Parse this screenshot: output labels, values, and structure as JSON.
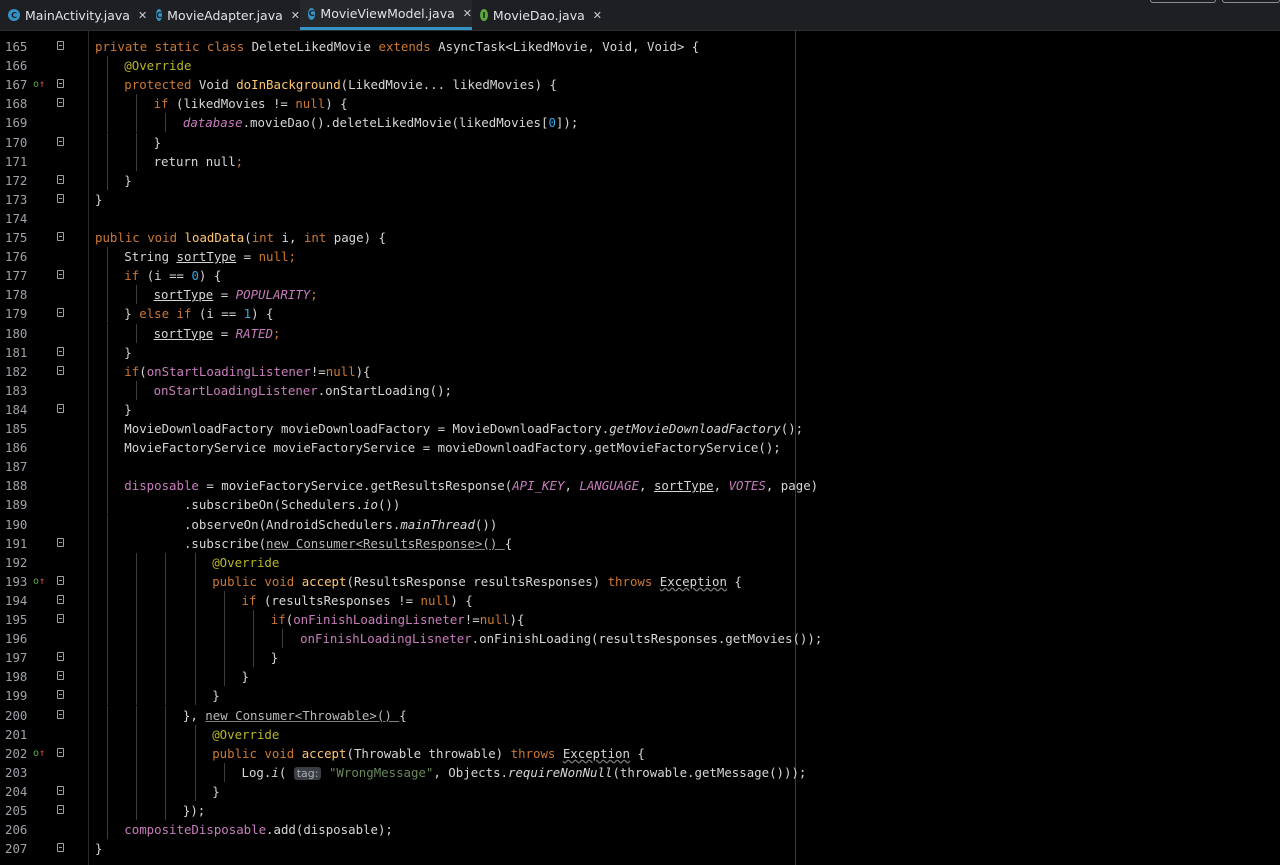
{
  "tabs": [
    {
      "label": "MainActivity.java",
      "icon": "C",
      "color": "#3592c4",
      "active": false
    },
    {
      "label": "MovieAdapter.java",
      "icon": "C",
      "color": "#3592c4",
      "active": false
    },
    {
      "label": "MovieViewModel.java",
      "icon": "C",
      "color": "#3592c4",
      "active": true
    },
    {
      "label": "MovieDao.java",
      "icon": "I",
      "color": "#5aab3c",
      "active": false
    }
  ],
  "close_glyph": "✕",
  "override_glyph": "o↑",
  "lines": [
    {
      "n": "165",
      "ind": 0,
      "fold": true,
      "c": [
        [
          "private static class ",
          "k"
        ],
        [
          "DeleteLikedMovie ",
          ""
        ],
        [
          "extends ",
          "k"
        ],
        [
          "AsyncTask<LikedMovie, Void, Void> {",
          ""
        ]
      ]
    },
    {
      "n": "166",
      "ind": 1,
      "c": [
        [
          "@Override",
          "ann"
        ]
      ]
    },
    {
      "n": "167",
      "ind": 1,
      "fold": true,
      "ovr": true,
      "c": [
        [
          "protected ",
          "k"
        ],
        [
          "Void ",
          ""
        ],
        [
          "doInBackground",
          "fn"
        ],
        [
          "(LikedMovie... likedMovies) {",
          ""
        ]
      ]
    },
    {
      "n": "168",
      "ind": 2,
      "fold": true,
      "c": [
        [
          "if ",
          "k"
        ],
        [
          "(likedMovies != ",
          ""
        ],
        [
          "null",
          "k"
        ],
        [
          ") {",
          ""
        ]
      ]
    },
    {
      "n": "169",
      "ind": 3,
      "c": [
        [
          "database",
          "pfi"
        ],
        [
          ".movieDao().deleteLikedMovie(likedMovies[",
          ""
        ],
        [
          "0",
          "num"
        ],
        [
          "]);",
          ""
        ]
      ]
    },
    {
      "n": "170",
      "ind": 2,
      "fold": true,
      "c": [
        [
          "}",
          ""
        ]
      ]
    },
    {
      "n": "171",
      "ind": 2,
      "c": [
        [
          "return null",
          ""
        ],
        [
          ";",
          "k"
        ]
      ]
    },
    {
      "n": "172",
      "ind": 1,
      "fold": true,
      "c": [
        [
          "}",
          ""
        ]
      ]
    },
    {
      "n": "173",
      "ind": 0,
      "fold": true,
      "c": [
        [
          "}",
          ""
        ]
      ]
    },
    {
      "n": "174",
      "ind": 0,
      "c": []
    },
    {
      "n": "175",
      "ind": 0,
      "fold": true,
      "c": [
        [
          "public void ",
          "k"
        ],
        [
          "loadData",
          "fn"
        ],
        [
          "(",
          ""
        ],
        [
          "int ",
          "k"
        ],
        [
          "i, ",
          ""
        ],
        [
          "int ",
          "k"
        ],
        [
          "page) {",
          ""
        ]
      ]
    },
    {
      "n": "176",
      "ind": 1,
      "c": [
        [
          "String ",
          ""
        ],
        [
          "sortType",
          "ul"
        ],
        [
          " = ",
          ""
        ],
        [
          "null",
          "k"
        ],
        [
          ";",
          "k"
        ]
      ]
    },
    {
      "n": "177",
      "ind": 1,
      "fold": true,
      "c": [
        [
          "if ",
          "k"
        ],
        [
          "(i == ",
          ""
        ],
        [
          "0",
          "num"
        ],
        [
          ") {",
          ""
        ]
      ]
    },
    {
      "n": "178",
      "ind": 2,
      "c": [
        [
          "sortType",
          "ul"
        ],
        [
          " = ",
          ""
        ],
        [
          "POPULARITY",
          "pfi"
        ],
        [
          ";",
          "k"
        ]
      ]
    },
    {
      "n": "179",
      "ind": 1,
      "fold": true,
      "c": [
        [
          "} ",
          ""
        ],
        [
          "else if ",
          "k"
        ],
        [
          "(i == ",
          ""
        ],
        [
          "1",
          "num"
        ],
        [
          ") {",
          ""
        ]
      ]
    },
    {
      "n": "180",
      "ind": 2,
      "c": [
        [
          "sortType",
          "ul"
        ],
        [
          " = ",
          ""
        ],
        [
          "RATED",
          "pfi"
        ],
        [
          ";",
          "k"
        ]
      ]
    },
    {
      "n": "181",
      "ind": 1,
      "fold": true,
      "c": [
        [
          "}",
          ""
        ]
      ]
    },
    {
      "n": "182",
      "ind": 1,
      "fold": true,
      "c": [
        [
          "if",
          "k"
        ],
        [
          "(",
          ""
        ],
        [
          "onStartLoadingListener",
          "pf"
        ],
        [
          "!=",
          ""
        ],
        [
          "null",
          "k"
        ],
        [
          "){",
          ""
        ]
      ]
    },
    {
      "n": "183",
      "ind": 2,
      "c": [
        [
          "onStartLoadingListener",
          "pf"
        ],
        [
          ".onStartLoading();",
          ""
        ]
      ]
    },
    {
      "n": "184",
      "ind": 1,
      "fold": true,
      "c": [
        [
          "}",
          ""
        ]
      ]
    },
    {
      "n": "185",
      "ind": 1,
      "c": [
        [
          "MovieDownloadFactory movieDownloadFactory = MovieDownloadFactory.",
          ""
        ],
        [
          "getMovieDownloadFactory",
          "it"
        ],
        [
          "();",
          ""
        ]
      ]
    },
    {
      "n": "186",
      "ind": 1,
      "c": [
        [
          "MovieFactoryService movieFactoryService = movieDownloadFactory.getMovieFactoryService();",
          ""
        ]
      ]
    },
    {
      "n": "187",
      "ind": 1,
      "c": []
    },
    {
      "n": "188",
      "ind": 1,
      "c": [
        [
          "disposable",
          "pf"
        ],
        [
          " = movieFactoryService.getResultsResponse(",
          ""
        ],
        [
          "API_KEY",
          "pfi"
        ],
        [
          ", ",
          ""
        ],
        [
          "LANGUAGE",
          "pfi"
        ],
        [
          ", ",
          ""
        ],
        [
          "sortType",
          "ul"
        ],
        [
          ", ",
          ""
        ],
        [
          "VOTES",
          "pfi"
        ],
        [
          ", page)",
          ""
        ]
      ]
    },
    {
      "n": "189",
      "ind": 1,
      "c": [
        [
          "        .subscribeOn(Schedulers.",
          ""
        ],
        [
          "io",
          "it"
        ],
        [
          "())",
          ""
        ]
      ]
    },
    {
      "n": "190",
      "ind": 1,
      "c": [
        [
          "        .observeOn(AndroidSchedulers.",
          ""
        ],
        [
          "mainThread",
          "it"
        ],
        [
          "())",
          ""
        ]
      ]
    },
    {
      "n": "191",
      "ind": 1,
      "fold": true,
      "c": [
        [
          "        .subscribe(",
          ""
        ],
        [
          "new Consumer<ResultsResponse>() ",
          "dim"
        ],
        [
          "{",
          ""
        ]
      ]
    },
    {
      "n": "192",
      "ind": 4,
      "c": [
        [
          "@Override",
          "ann"
        ]
      ]
    },
    {
      "n": "193",
      "ind": 4,
      "fold": true,
      "ovr": true,
      "c": [
        [
          "public void ",
          "k"
        ],
        [
          "accept",
          "fn"
        ],
        [
          "(ResultsResponse resultsResponses) ",
          ""
        ],
        [
          "throws ",
          "k"
        ],
        [
          "Exception",
          "wavy"
        ],
        [
          " {",
          ""
        ]
      ]
    },
    {
      "n": "194",
      "ind": 5,
      "fold": true,
      "c": [
        [
          "if ",
          "k"
        ],
        [
          "(resultsResponses != ",
          ""
        ],
        [
          "null",
          "k"
        ],
        [
          ") {",
          ""
        ]
      ]
    },
    {
      "n": "195",
      "ind": 6,
      "fold": true,
      "c": [
        [
          "if",
          "k"
        ],
        [
          "(",
          ""
        ],
        [
          "onFinishLoadingLisneter",
          "pf"
        ],
        [
          "!=",
          ""
        ],
        [
          "null",
          "k"
        ],
        [
          "){",
          ""
        ]
      ]
    },
    {
      "n": "196",
      "ind": 7,
      "c": [
        [
          "onFinishLoadingLisneter",
          "pf"
        ],
        [
          ".onFinishLoading(resultsResponses.getMovies());",
          ""
        ]
      ]
    },
    {
      "n": "197",
      "ind": 6,
      "fold": true,
      "c": [
        [
          "}",
          ""
        ]
      ]
    },
    {
      "n": "198",
      "ind": 5,
      "fold": true,
      "c": [
        [
          "}",
          ""
        ]
      ]
    },
    {
      "n": "199",
      "ind": 4,
      "fold": true,
      "c": [
        [
          "}",
          ""
        ]
      ]
    },
    {
      "n": "200",
      "ind": 3,
      "fold": true,
      "c": [
        [
          "}, ",
          ""
        ],
        [
          "new Consumer<Throwable>() ",
          "dim"
        ],
        [
          "{",
          ""
        ]
      ]
    },
    {
      "n": "201",
      "ind": 4,
      "c": [
        [
          "@Override",
          "ann"
        ]
      ]
    },
    {
      "n": "202",
      "ind": 4,
      "fold": true,
      "ovr": true,
      "c": [
        [
          "public void ",
          "k"
        ],
        [
          "accept",
          "fn"
        ],
        [
          "(Throwable throwable) ",
          ""
        ],
        [
          "throws ",
          "k"
        ],
        [
          "Exception",
          "wavy"
        ],
        [
          " {",
          ""
        ]
      ]
    },
    {
      "n": "203",
      "ind": 5,
      "c": [
        [
          "Log.",
          ""
        ],
        [
          "i",
          "it"
        ],
        [
          "( ",
          ""
        ],
        [
          "tag:",
          "hint"
        ],
        [
          " ",
          ""
        ],
        [
          "\"WrongMessage\"",
          "str"
        ],
        [
          ", Objects.",
          ""
        ],
        [
          "requireNonNull",
          "it"
        ],
        [
          "(throwable.getMessage()));",
          ""
        ]
      ]
    },
    {
      "n": "204",
      "ind": 4,
      "fold": true,
      "c": [
        [
          "}",
          ""
        ]
      ]
    },
    {
      "n": "205",
      "ind": 3,
      "fold": true,
      "c": [
        [
          "});",
          ""
        ]
      ]
    },
    {
      "n": "206",
      "ind": 1,
      "c": [
        [
          "compositeDisposable",
          "pf"
        ],
        [
          ".add(disposable);",
          ""
        ]
      ]
    },
    {
      "n": "207",
      "ind": 0,
      "fold": true,
      "c": [
        [
          "}",
          ""
        ]
      ]
    }
  ]
}
